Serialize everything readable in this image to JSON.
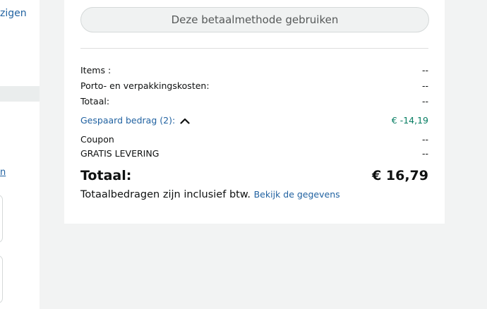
{
  "left": {
    "top_link": "zigen",
    "mid_link": "n"
  },
  "payment": {
    "use_button_label": "Deze betaalmethode gebruiken"
  },
  "summary": {
    "items_label": "Items :",
    "items_value": "--",
    "shipping_label": "Porto- en verpakkingskosten:",
    "shipping_value": "--",
    "subtotal_label": "Totaal:",
    "subtotal_value": "--",
    "saved_label": "Gespaard bedrag (2):",
    "saved_value": "€ -14,19",
    "coupon_label": "Coupon",
    "coupon_value": "--",
    "free_delivery_label": "GRATIS LEVERING",
    "free_delivery_value": "--",
    "total_label": "Totaal:",
    "total_value": "€ 16,79",
    "vat_note": "Totaalbedragen zijn inclusief btw.",
    "vat_link": "Bekijk de gegevens"
  },
  "colors": {
    "link": "#2162a1",
    "savings": "#067d62",
    "background": "#f2f3f3"
  },
  "icons": {
    "saved_toggle": "chevron-up-icon"
  }
}
